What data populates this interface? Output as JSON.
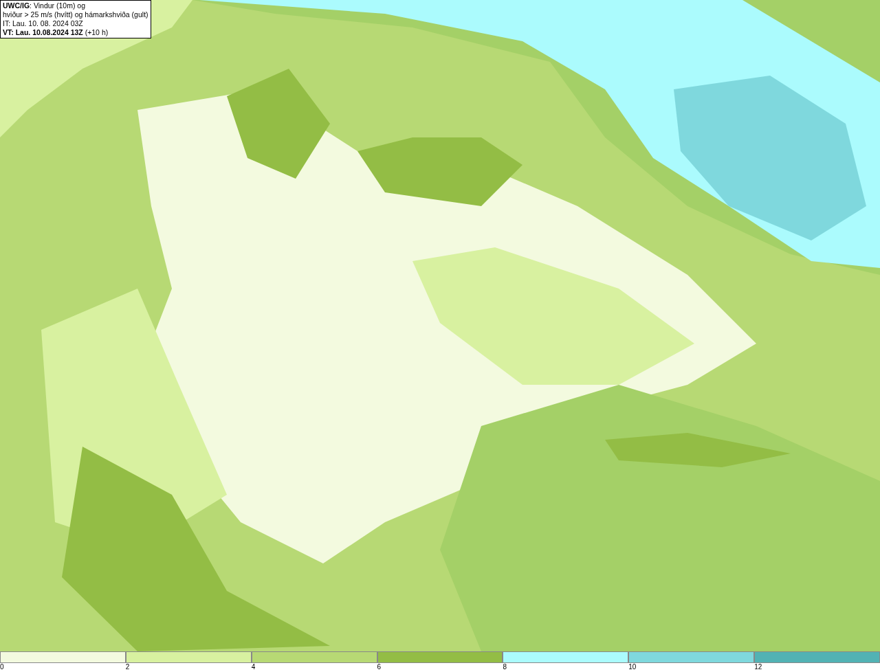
{
  "header": {
    "lines": [
      "**UWC/IG**: Vindur (10m) og",
      "hviður > 25 m/s (hvítt) og hámarkshviða (gult)",
      "IT: Lau. 10. 08. 2024 03Z",
      "**VT: Lau. 10.08.2024 13Z** (+10 h)"
    ]
  },
  "color_bar": [
    {
      "label": "0",
      "color": "#f3fadf"
    },
    {
      "label": "2",
      "color": "#d8f1a0"
    },
    {
      "label": "4",
      "color": "#b7d974"
    },
    {
      "label": "6",
      "color": "#93bd45"
    },
    {
      "label": "8",
      "color": "#abfbfd"
    },
    {
      "label": "10",
      "color": "#7fd8dd"
    },
    {
      "label": "12",
      "color": "#52b2b4"
    }
  ]
}
